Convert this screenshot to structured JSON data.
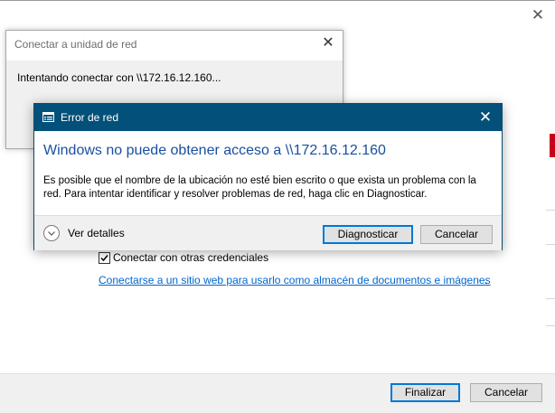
{
  "wizard": {
    "close_glyph": "✕",
    "other_credentials_label": "Conectar con otras credenciales",
    "other_credentials_checked": true,
    "web_link_text": "Conectarse a un sitio web para usarlo como almacén de documentos e imágenes",
    "web_link_suffix": ".",
    "finish_label": "Finalizar",
    "cancel_label": "Cancelar",
    "accent_color": "#c4001b"
  },
  "connecting_dialog": {
    "title": "Conectar a unidad de red",
    "close_glyph": "✕",
    "message": "Intentando conectar con \\\\172.16.12.160..."
  },
  "error_dialog": {
    "title": "Error de red",
    "close_glyph": "✕",
    "heading": "Windows no puede obtener acceso a \\\\172.16.12.160",
    "description": "Es posible que el nombre de la ubicación no esté bien escrito o que exista un problema con la red. Para intentar identificar y resolver problemas de red, haga clic en Diagnosticar.",
    "details_label": "Ver detalles",
    "diagnose_label": "Diagnosticar",
    "cancel_label": "Cancelar",
    "titlebar_color": "#03507a",
    "heading_color": "#1a4fa0"
  },
  "icons": {
    "error_app_icon": "network-error-icon",
    "details_toggle_icon": "chevron-down-circle-icon",
    "checkbox_icon": "checkmark-icon"
  }
}
